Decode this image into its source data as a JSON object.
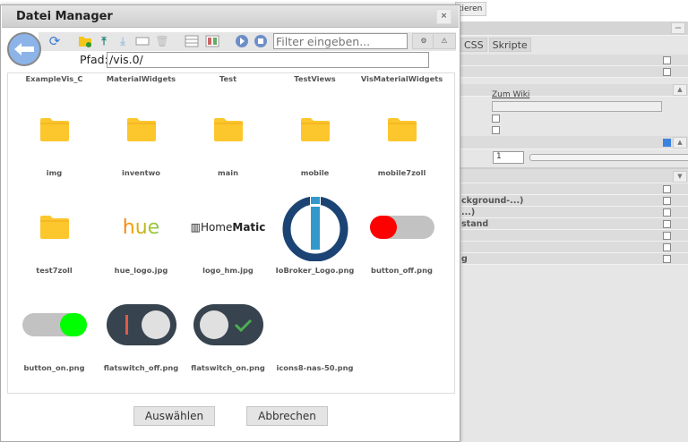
{
  "background": {
    "button_label": "tieren",
    "tabs": [
      "CSS",
      "Skripte"
    ],
    "link": "Zum Wiki",
    "number_value": "1",
    "rows": [
      "ckground-...)",
      "...)",
      "stand",
      "g"
    ]
  },
  "dialog": {
    "title": "Datei Manager",
    "close_label": "×",
    "filter_placeholder": "Filter eingeben...",
    "path_label": "Pfad:",
    "path_value": "/vis.0/",
    "select_label": "Auswählen",
    "cancel_label": "Abbrechen",
    "settings_label": "⚙",
    "warning_label": "⚠",
    "items": [
      {
        "name": "ExampleVis_C",
        "icon": "none"
      },
      {
        "name": "MaterialWidgets",
        "icon": "none"
      },
      {
        "name": "Test",
        "icon": "none"
      },
      {
        "name": "TestViews",
        "icon": "none"
      },
      {
        "name": "VisMaterialWidgets",
        "icon": "none"
      },
      {
        "name": "img",
        "icon": "folder"
      },
      {
        "name": "inventwo",
        "icon": "folder"
      },
      {
        "name": "main",
        "icon": "folder"
      },
      {
        "name": "mobile",
        "icon": "folder"
      },
      {
        "name": "mobile7zoll",
        "icon": "folder"
      },
      {
        "name": "test7zoll",
        "icon": "folder"
      },
      {
        "name": "hue_logo.jpg",
        "icon": "hue"
      },
      {
        "name": "logo_hm.jpg",
        "icon": "homematic"
      },
      {
        "name": "IoBroker_Logo.png",
        "icon": "iobroker"
      },
      {
        "name": "button_off.png",
        "icon": "toggle-red"
      },
      {
        "name": "button_on.png",
        "icon": "toggle-green"
      },
      {
        "name": "flatswitch_off.png",
        "icon": "flat-off"
      },
      {
        "name": "flatswitch_on.png",
        "icon": "flat-on"
      },
      {
        "name": "icons8-nas-50.png",
        "icon": "none"
      }
    ],
    "logo_texts": {
      "hue": "hue",
      "hm_a": "Home",
      "hm_b": "Matic"
    }
  }
}
